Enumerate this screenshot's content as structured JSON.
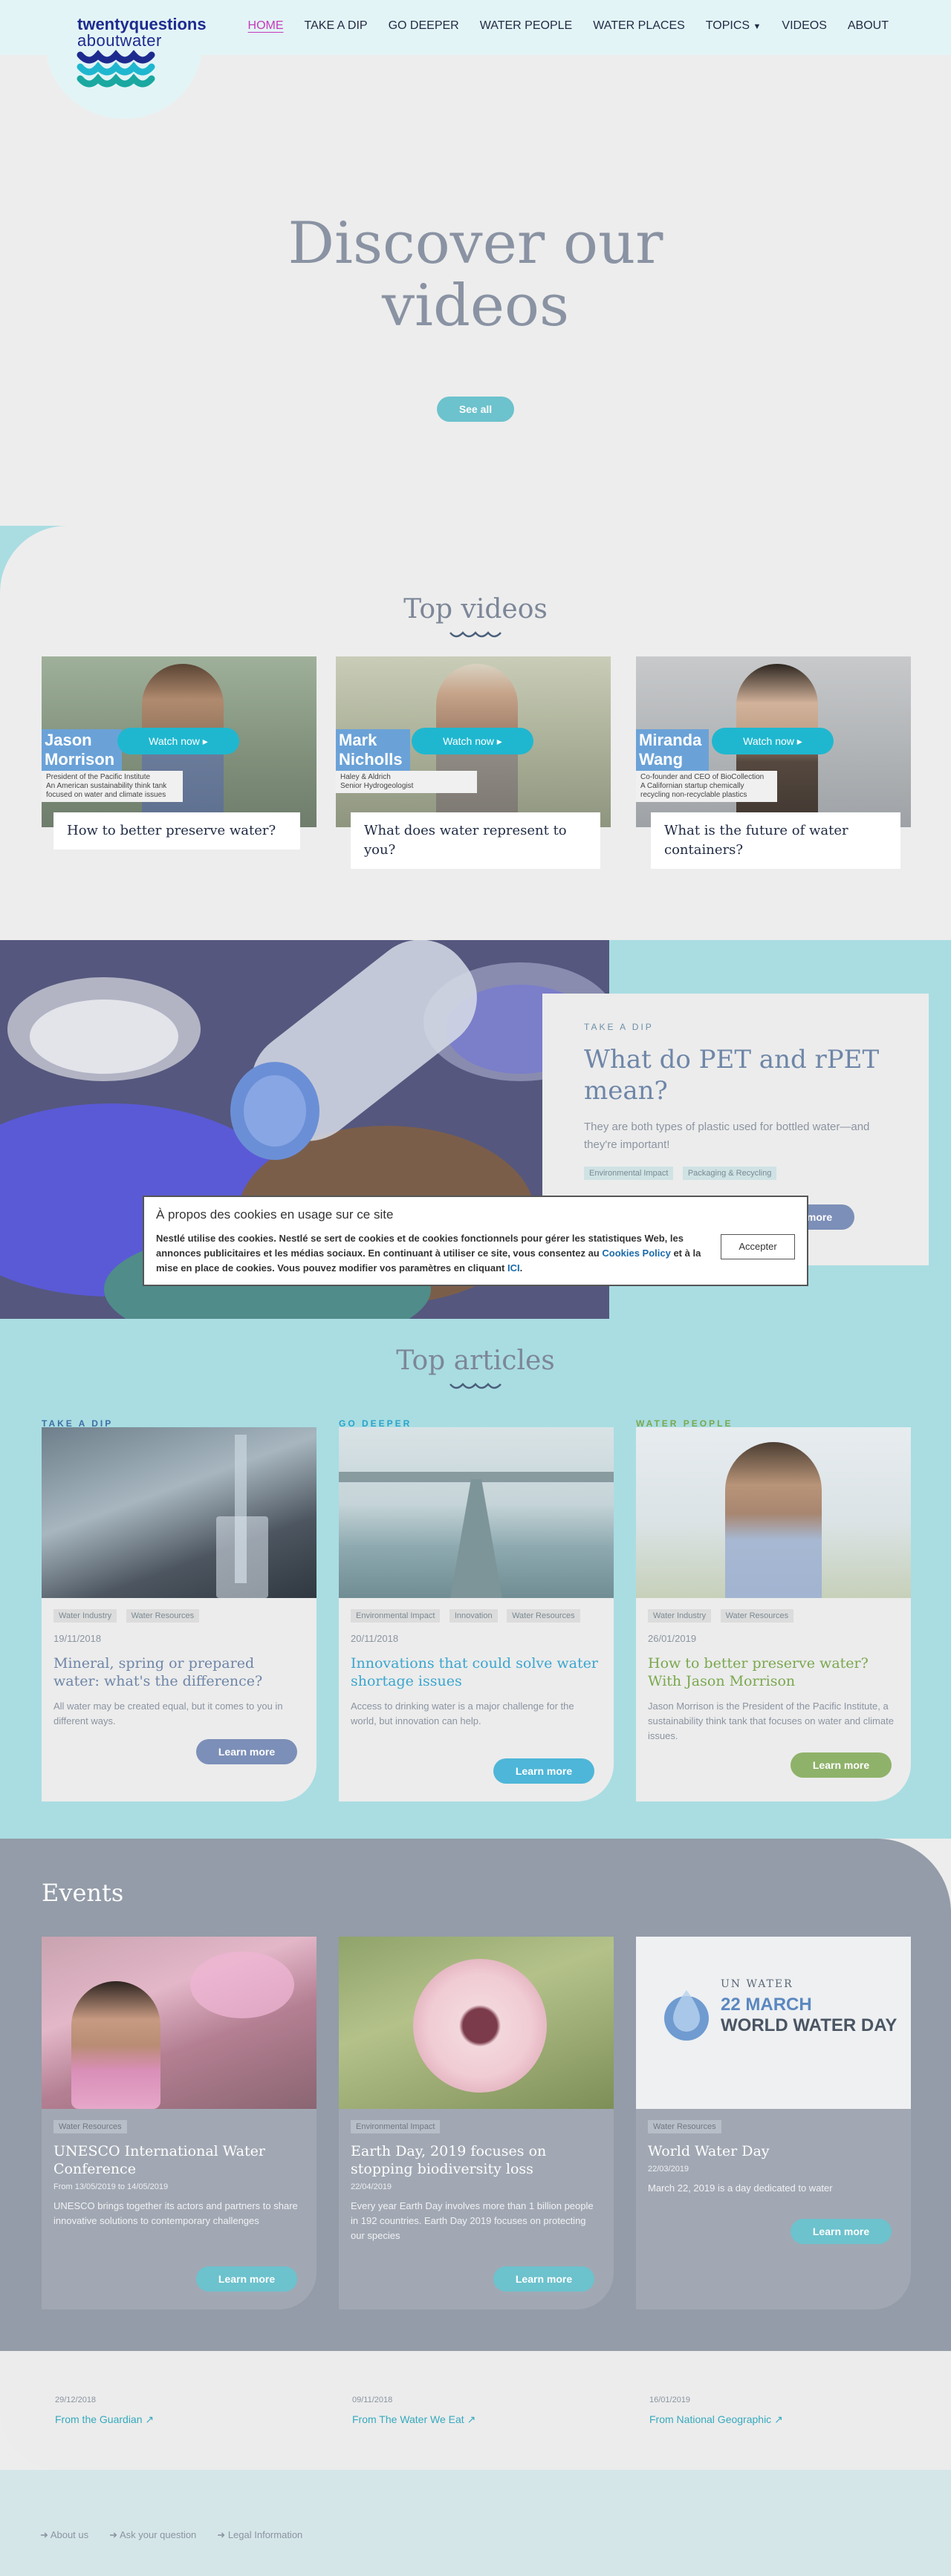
{
  "header": {
    "logo_line1": "twentyquestions",
    "logo_line2": "aboutwater",
    "nav": [
      {
        "label": "HOME",
        "active": true
      },
      {
        "label": "TAKE A DIP"
      },
      {
        "label": "GO DEEPER"
      },
      {
        "label": "WATER PEOPLE"
      },
      {
        "label": "WATER PLACES"
      },
      {
        "label": "TOPICS"
      },
      {
        "label": "VIDEOS"
      },
      {
        "label": "ABOUT"
      }
    ]
  },
  "hero": {
    "title_line1": "Discover our",
    "title_line2": "videos",
    "see_all": "See all"
  },
  "top_videos": {
    "title": "Top videos",
    "watch_label": "Watch now",
    "items": [
      {
        "first": "Jason",
        "last": "Morrison",
        "desc1": "President of the Pacific Institute",
        "desc2": "An American sustainability think tank",
        "desc3": "focused on water and climate issues",
        "caption": "How to better preserve water?"
      },
      {
        "first": "Mark",
        "last": "Nicholls",
        "desc1": "Haley & Aldrich",
        "desc2": "Senior Hydrogeologist",
        "desc3": "",
        "caption": "What does water represent to you?"
      },
      {
        "first": "Miranda",
        "last": "Wang",
        "desc1": "Co-founder and CEO of BioCollection",
        "desc2": "A Californian startup chemically recycling non-recyclable plastics",
        "desc3": "",
        "caption": "What is the future of water containers?"
      }
    ]
  },
  "featured": {
    "kicker": "TAKE A DIP",
    "title": "What do PET and rPET mean?",
    "text": "They are both types of plastic used for bottled water—and they're important!",
    "tags": [
      "Environmental Impact",
      "Packaging & Recycling"
    ],
    "button": "Learn more"
  },
  "cookie": {
    "title": "À propos des cookies en usage sur ce site",
    "text_before": "Nestlé utilise des cookies. Nestlé se sert de cookies et de cookies fonctionnels pour gérer les statistiques Web, les annonces publicitaires et les médias sociaux. En continuant à utiliser ce site, vous consentez au ",
    "policy_link": "Cookies Policy",
    "text_middle": " et à la mise en place de cookies. Vous pouvez modifier vos paramètres en cliquant ",
    "here_link": "ICI",
    "text_after": ".",
    "accept": "Accepter"
  },
  "top_articles": {
    "title": "Top articles",
    "items": [
      {
        "kicker": "TAKE A DIP",
        "tags": [
          "Water Industry",
          "Water Resources"
        ],
        "date": "19/11/2018",
        "title": "Mineral, spring or prepared water: what's the difference?",
        "text": "All water may be created equal, but it comes to you in different ways.",
        "button": "Learn more"
      },
      {
        "kicker": "GO DEEPER",
        "tags": [
          "Environmental Impact",
          "Innovation",
          "Water Resources"
        ],
        "date": "20/11/2018",
        "title": "Innovations that could solve water shortage issues",
        "text": "Access to drinking water is a major challenge for the world, but innovation can help.",
        "button": "Learn more"
      },
      {
        "kicker": "WATER PEOPLE",
        "tags": [
          "Water Industry",
          "Water Resources"
        ],
        "date": "26/01/2019",
        "title": "How to better preserve water? With Jason Morrison",
        "text": "Jason Morrison is the President of the Pacific Institute, a sustainability think tank that focuses on water and climate issues.",
        "button": "Learn more"
      }
    ]
  },
  "events": {
    "title": "Events",
    "items": [
      {
        "tag": "Water Resources",
        "title": "UNESCO International Water Conference",
        "date": "From 13/05/2019  to 14/05/2019",
        "text": "UNESCO brings together its actors and partners to share innovative solutions to contemporary challenges",
        "button": "Learn more"
      },
      {
        "tag": "Environmental Impact",
        "title": "Earth Day, 2019 focuses on stopping biodiversity loss",
        "date": "22/04/2019",
        "text": "Every year Earth Day involves more than 1 billion people in 192 countries. Earth Day 2019 focuses on protecting our species",
        "button": "Learn more"
      },
      {
        "tag": "Water Resources",
        "title": "World Water Day",
        "date": "22/03/2019",
        "text": "March 22, 2019 is a day dedicated to water",
        "button": "Learn more",
        "logo_top": "UN WATER",
        "logo_date": "22 MARCH",
        "logo_main": "WORLD WATER DAY"
      }
    ]
  },
  "news": [
    {
      "date": "29/12/2018",
      "link": "From the Guardian"
    },
    {
      "date": "09/11/2018",
      "link": "From The Water We Eat"
    },
    {
      "date": "16/01/2019",
      "link": "From National Geographic"
    }
  ],
  "footer": {
    "links": [
      "About us",
      "Ask your question",
      "Legal Information"
    ]
  }
}
